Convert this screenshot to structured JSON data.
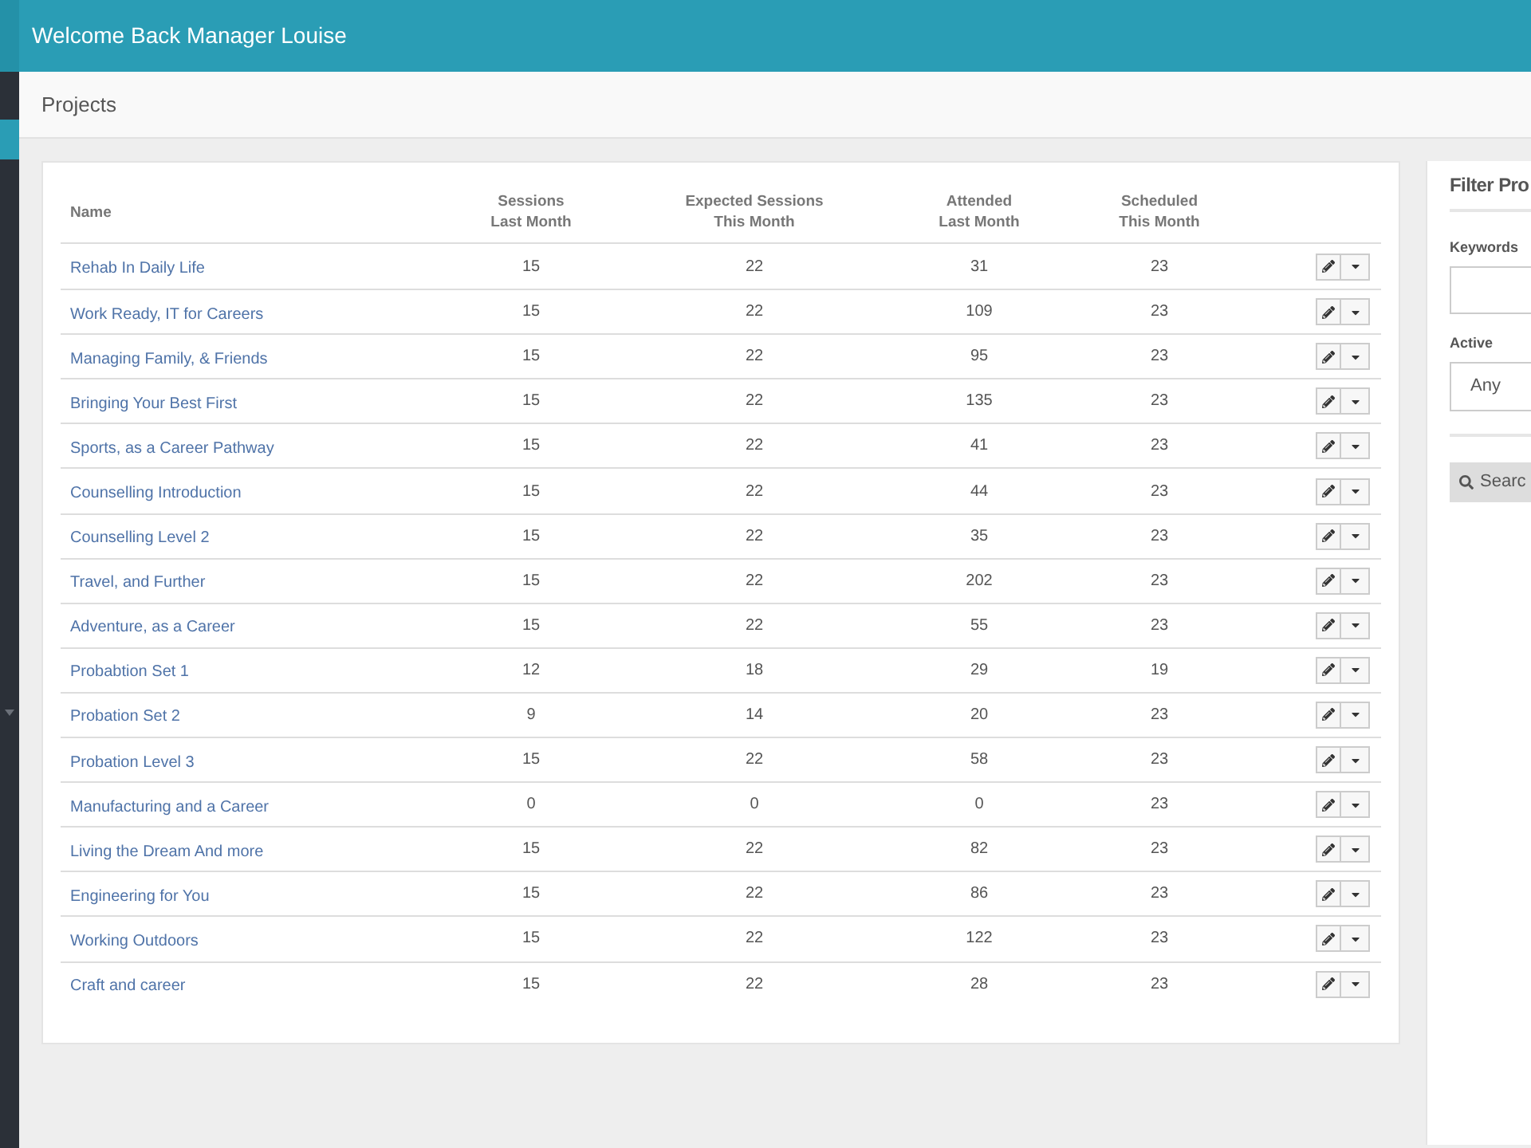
{
  "header": {
    "title": "Welcome Back Manager Louise"
  },
  "sidebar": {
    "items": [
      {
        "selected": true
      }
    ]
  },
  "page": {
    "title": "Projects"
  },
  "table": {
    "columns": [
      "Name",
      "Sessions\nLast Month",
      "Expected Sessions\nThis Month",
      "Attended\nLast Month",
      "Scheduled\nThis Month"
    ],
    "rows": [
      [
        "Rehab In Daily Life",
        "15",
        "22",
        "31",
        "23"
      ],
      [
        "Work Ready, IT for Careers",
        "15",
        "22",
        "109",
        "23"
      ],
      [
        "Managing Family, & Friends",
        "15",
        "22",
        "95",
        "23"
      ],
      [
        "Bringing Your Best First",
        "15",
        "22",
        "135",
        "23"
      ],
      [
        "Sports, as a Career Pathway",
        "15",
        "22",
        "41",
        "23"
      ],
      [
        "Counselling Introduction",
        "15",
        "22",
        "44",
        "23"
      ],
      [
        "Counselling Level 2",
        "15",
        "22",
        "35",
        "23"
      ],
      [
        "Travel, and Further",
        "15",
        "22",
        "202",
        "23"
      ],
      [
        "Adventure, as a Career",
        "15",
        "22",
        "55",
        "23"
      ],
      [
        "Probabtion Set 1",
        "12",
        "18",
        "29",
        "19"
      ],
      [
        "Probation Set 2",
        "9",
        "14",
        "20",
        "23"
      ],
      [
        "Probation Level 3",
        "15",
        "22",
        "58",
        "23"
      ],
      [
        "Manufacturing and a Career",
        "0",
        "0",
        "0",
        "23"
      ],
      [
        "Living the Dream And more",
        "15",
        "22",
        "82",
        "23"
      ],
      [
        "Engineering for You",
        "15",
        "22",
        "86",
        "23"
      ],
      [
        "Working Outdoors",
        "15",
        "22",
        "122",
        "23"
      ],
      [
        "Craft and career",
        "15",
        "22",
        "28",
        "23"
      ]
    ]
  },
  "filter": {
    "title": "Filter Pro",
    "fields": [
      {
        "kind": "text",
        "label": "Keywords"
      },
      {
        "kind": "select",
        "label": "Active",
        "value": "Any"
      }
    ],
    "button": "Searc"
  }
}
